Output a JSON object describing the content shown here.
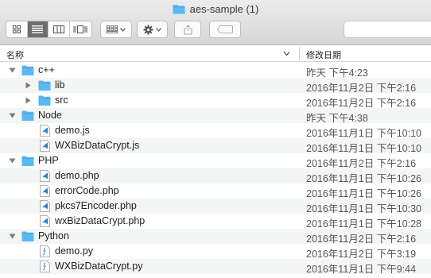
{
  "window": {
    "title": "aes-sample (1)"
  },
  "toolbar": {
    "view_buttons": [
      "icon-view",
      "list-view",
      "column-view",
      "cover-flow-view"
    ],
    "active_view": "list-view"
  },
  "columns": {
    "name": "名称",
    "date_modified": "修改日期"
  },
  "colors": {
    "folder": "#5bb8f3",
    "active_button": "#6e6e6e",
    "alt_row": "#f4f5f5"
  },
  "rows": [
    {
      "label": "c++",
      "date": "昨天 下午4:23",
      "type": "folder",
      "expanded": true
    },
    {
      "label": "lib",
      "date": "2016年11月2日 下午2:16",
      "type": "folder",
      "expanded": false
    },
    {
      "label": "src",
      "date": "2016年11月2日 下午2:16",
      "type": "folder",
      "expanded": false
    },
    {
      "label": "Node",
      "date": "昨天 下午4:38",
      "type": "folder",
      "expanded": true
    },
    {
      "label": "demo.js",
      "date": "2016年11月1日 下午10:10",
      "type": "vscode-file"
    },
    {
      "label": "WXBizDataCrypt.js",
      "date": "2016年11月1日 下午10:10",
      "type": "vscode-file"
    },
    {
      "label": "PHP",
      "date": "2016年11月2日 下午2:16",
      "type": "folder",
      "expanded": true
    },
    {
      "label": "demo.php",
      "date": "2016年11月1日 下午10:26",
      "type": "vscode-file"
    },
    {
      "label": "errorCode.php",
      "date": "2016年11月1日 下午10:26",
      "type": "vscode-file"
    },
    {
      "label": "pkcs7Encoder.php",
      "date": "2016年11月1日 下午10:30",
      "type": "vscode-file"
    },
    {
      "label": "wxBizDataCrypt.php",
      "date": "2016年11月1日 下午10:28",
      "type": "vscode-file"
    },
    {
      "label": "Python",
      "date": "2016年11月2日 下午2:16",
      "type": "folder",
      "expanded": true
    },
    {
      "label": "demo.py",
      "date": "2016年11月2日 下午3:19",
      "type": "script-file"
    },
    {
      "label": "WXBizDataCrypt.py",
      "date": "2016年11月1日 下午9:44",
      "type": "script-file"
    }
  ]
}
